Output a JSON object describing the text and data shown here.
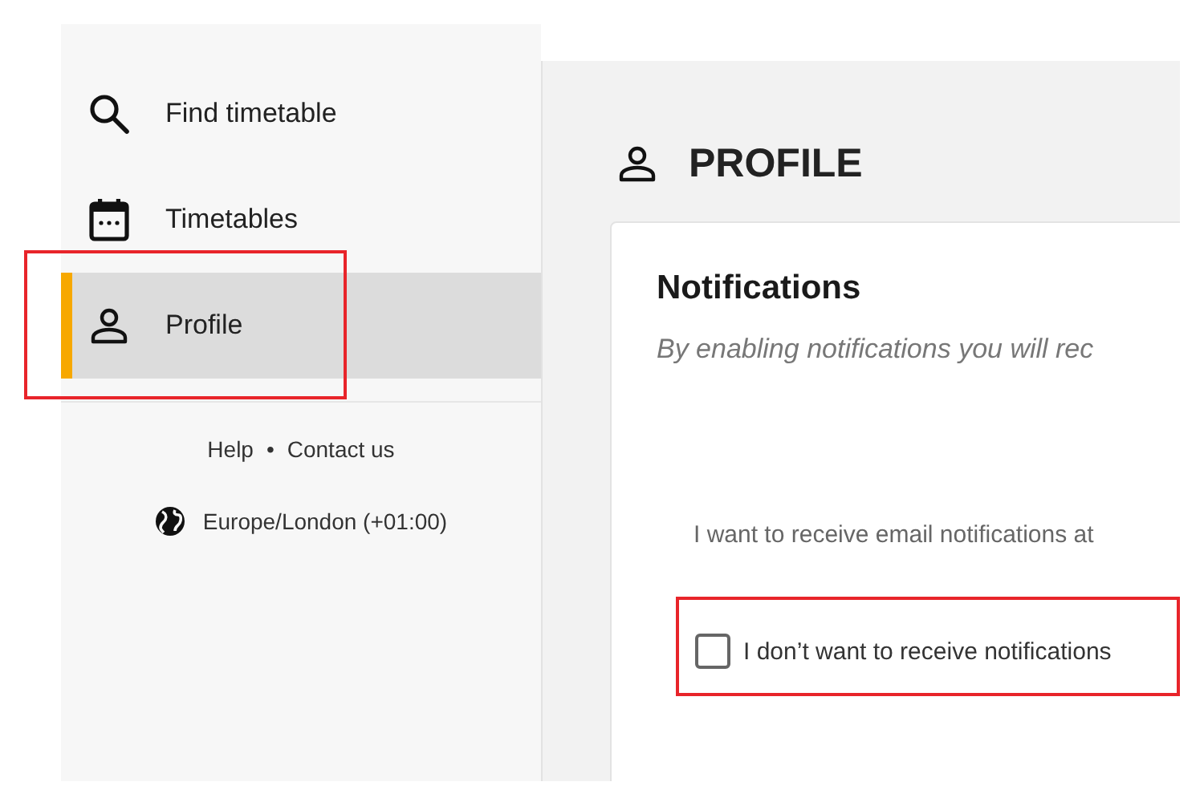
{
  "sidebar": {
    "items": [
      {
        "label": "Find timetable",
        "kind": "search",
        "selected": false,
        "highlighted": false
      },
      {
        "label": "Timetables",
        "kind": "calendar",
        "selected": false,
        "highlighted": false
      },
      {
        "label": "Profile",
        "kind": "person",
        "selected": true,
        "highlighted": true
      }
    ],
    "footer_links": [
      "Help",
      "Contact us"
    ],
    "separator": "•",
    "timezone": "Europe/London (+01:00)"
  },
  "page": {
    "title": "PROFILE"
  },
  "notifications": {
    "title": "Notifications",
    "description": "By enabling notifications you will rec",
    "email_label": "I want to receive email notifications at",
    "opt_out": {
      "label": "I don’t want to receive notifications",
      "checked": false,
      "highlighted": true
    }
  }
}
